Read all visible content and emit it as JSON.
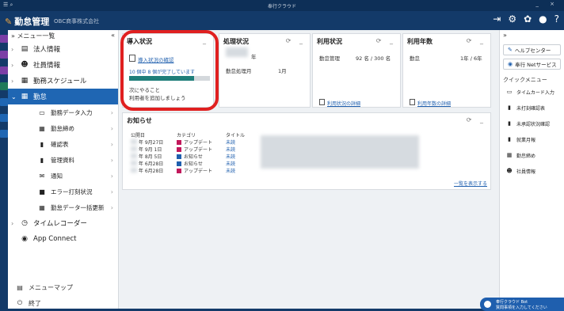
{
  "titlebar": {
    "left_icons": "☰ ⌕",
    "center": "奉行クラウド",
    "right_controls": "_ ×"
  },
  "appbar": {
    "product": "勤怠管理",
    "company": "OBC商事株式会社"
  },
  "sidebar": {
    "header": "メニュー一覧",
    "items": [
      {
        "label": "法人情報"
      },
      {
        "label": "社員情報"
      },
      {
        "label": "勤務スケジュール"
      },
      {
        "label": "勤怠"
      }
    ],
    "sub_items": [
      {
        "label": "勤務データ入力"
      },
      {
        "label": "勤怠締め"
      },
      {
        "label": "確認表"
      },
      {
        "label": "管理資料"
      },
      {
        "label": "通知"
      },
      {
        "label": "エラー打刻状況"
      },
      {
        "label": "勤怠データ一括更新"
      }
    ],
    "after_items": [
      {
        "label": "タイムレコーダー"
      },
      {
        "label": "App Connect"
      }
    ],
    "footer": [
      {
        "label": "メニューマップ"
      },
      {
        "label": "終了"
      }
    ]
  },
  "intro": {
    "title": "導入状況",
    "link": "導入状況の確認",
    "progress_text": "10 個中 8 個が完了しています",
    "progress": 0.8,
    "todo_heading": "次にやること",
    "todo_body": "利用者を追加しましょう"
  },
  "process": {
    "title": "処理状況",
    "year_suffix": "年",
    "row_label": "勤怠処理月",
    "row_value": "1月"
  },
  "usage": {
    "title": "利用状況",
    "row_label": "勤怠管理",
    "row_value": "92 名 / 300 名",
    "link": "利用状況の詳細"
  },
  "years": {
    "title": "利用年数",
    "row_label": "勤怠",
    "row_value": "1年 / 6年",
    "link": "利用年数の詳細"
  },
  "notices": {
    "title": "お知らせ",
    "headers": [
      "公開日",
      "カテゴリ",
      "タイトル"
    ],
    "rows": [
      {
        "date": "年  9月27日",
        "category": "アップデート",
        "cat_color": "#c2185b",
        "status": "未読"
      },
      {
        "date": "年  9月 1日",
        "category": "アップデート",
        "cat_color": "#c2185b",
        "status": "未読"
      },
      {
        "date": "年  8月 5日",
        "category": "お知らせ",
        "cat_color": "#1f5fae",
        "status": "未読"
      },
      {
        "date": "年  6月28日",
        "category": "お知らせ",
        "cat_color": "#1f5fae",
        "status": "未読"
      },
      {
        "date": "年  6月28日",
        "category": "アップデート",
        "cat_color": "#c2185b",
        "status": "未読"
      }
    ],
    "more_link": "一覧を表示する"
  },
  "rpanel": {
    "help": "ヘルプセンター",
    "net": "奉行 Netサービス",
    "quick_label": "クイックメニュー",
    "items": [
      {
        "label": "タイムカード入力"
      },
      {
        "label": "未打刻確認表"
      },
      {
        "label": "未承認状況確認"
      },
      {
        "label": "就業月報"
      },
      {
        "label": "勤怠締め"
      },
      {
        "label": "社員情報"
      }
    ]
  },
  "chat": {
    "line1": "奉行クラウド Bot",
    "line2": "質問事項を入力してください"
  },
  "colors": {
    "header": "#133a69",
    "accent": "#1f66b3",
    "progress": "#1e7e7a",
    "highlight_ring": "#e02020"
  }
}
